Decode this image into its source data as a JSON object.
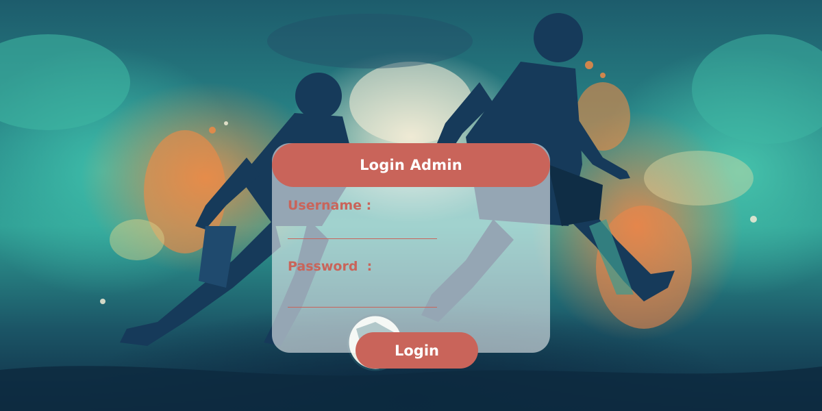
{
  "login": {
    "title": "Login Admin",
    "username_label": "Username :",
    "username_value": "",
    "password_label": "Password  :",
    "password_value": "",
    "submit_label": "Login"
  },
  "theme": {
    "accent": "#c9645a",
    "card_bg": "rgba(255,255,255,0.55)"
  },
  "background": {
    "description_icon": "soccer-players-illustration"
  }
}
